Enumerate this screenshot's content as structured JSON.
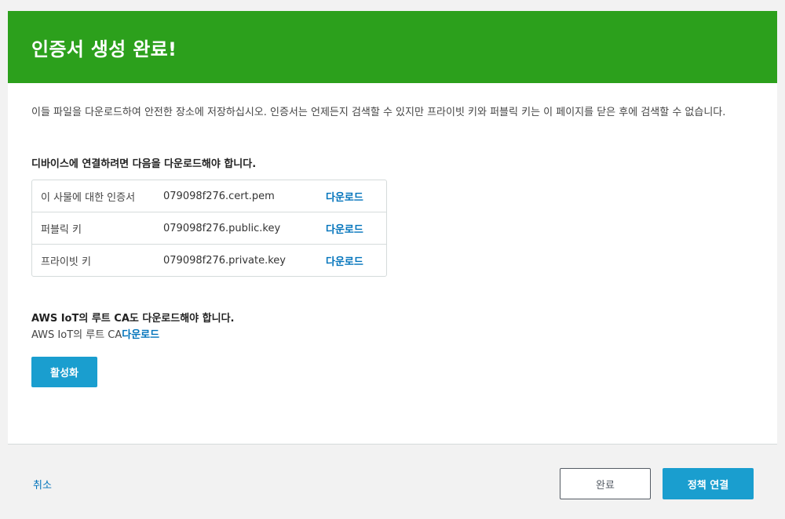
{
  "banner": {
    "title": "인증서 생성 완료!"
  },
  "intro_text": "이들 파일을 다운로드하여 안전한 장소에 저장하십시오. 인증서는 언제든지 검색할 수 있지만 프라이빗 키와 퍼블릭 키는 이 페이지를 닫은 후에 검색할 수 없습니다.",
  "device_section": {
    "heading": "디바이스에 연결하려면 다음을 다운로드해야 합니다.",
    "files": [
      {
        "label": "이 사물에 대한 인증서",
        "filename": "079098f276.cert.pem",
        "action": "다운로드"
      },
      {
        "label": "퍼블릭 키",
        "filename": "079098f276.public.key",
        "action": "다운로드"
      },
      {
        "label": "프라이빗 키",
        "filename": "079098f276.private.key",
        "action": "다운로드"
      }
    ]
  },
  "root_ca": {
    "heading": "AWS IoT의 루트 CA도 다운로드해야 합니다.",
    "line_prefix": "AWS IoT의 루트 CA",
    "link": "다운로드"
  },
  "activate_button": "활성화",
  "footer": {
    "cancel": "취소",
    "done": "완료",
    "attach_policy": "정책 연결"
  },
  "colors": {
    "banner": "#2ca01c",
    "primary_button": "#1a9ecf",
    "link": "#0073bb"
  }
}
